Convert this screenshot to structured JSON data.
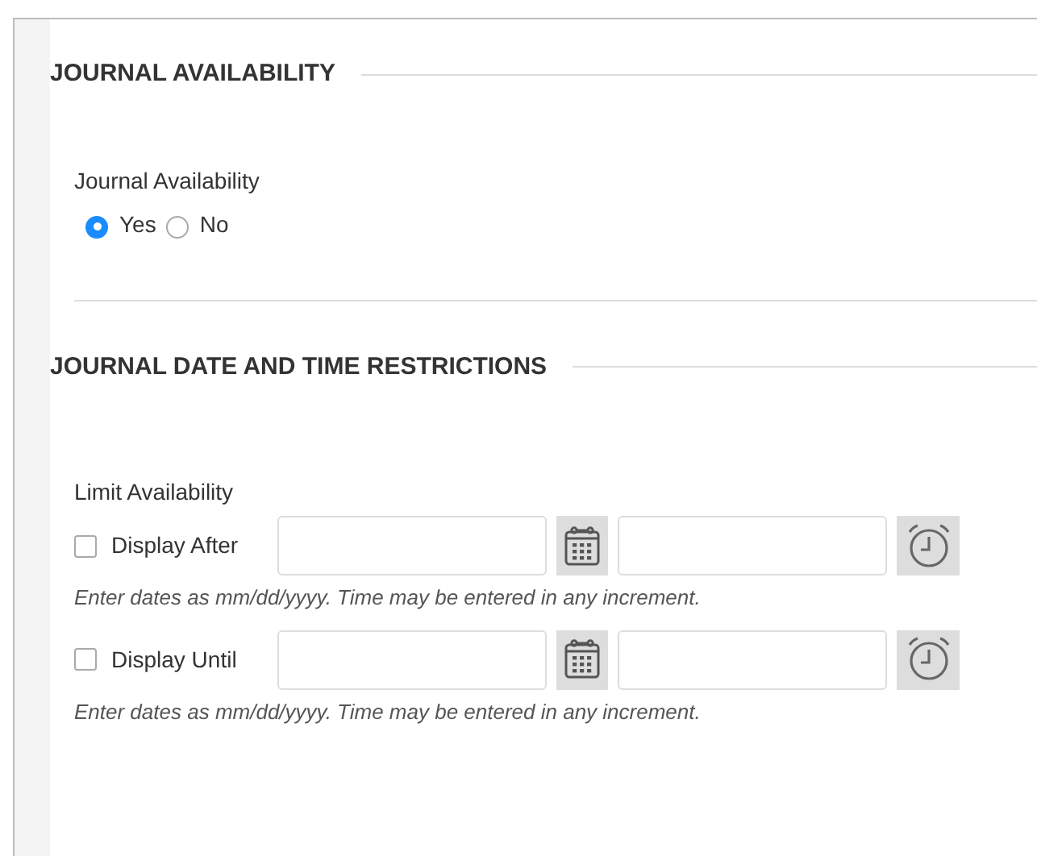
{
  "sections": [
    {
      "kind": "radio",
      "title": "JOURNAL AVAILABILITY",
      "label": "Journal Availability",
      "options": [
        {
          "label": "Yes",
          "selected": true
        },
        {
          "label": "No",
          "selected": false
        }
      ]
    },
    {
      "kind": "dates",
      "title": "JOURNAL DATE AND TIME RESTRICTIONS",
      "label": "Limit Availability",
      "rows": [
        {
          "label": "Display After",
          "checked": false,
          "hint": "Enter dates as mm/dd/yyyy. Time may be entered in any increment."
        },
        {
          "label": "Display Until",
          "checked": false,
          "hint": "Enter dates as mm/dd/yyyy. Time may be entered in any increment."
        }
      ]
    }
  ]
}
